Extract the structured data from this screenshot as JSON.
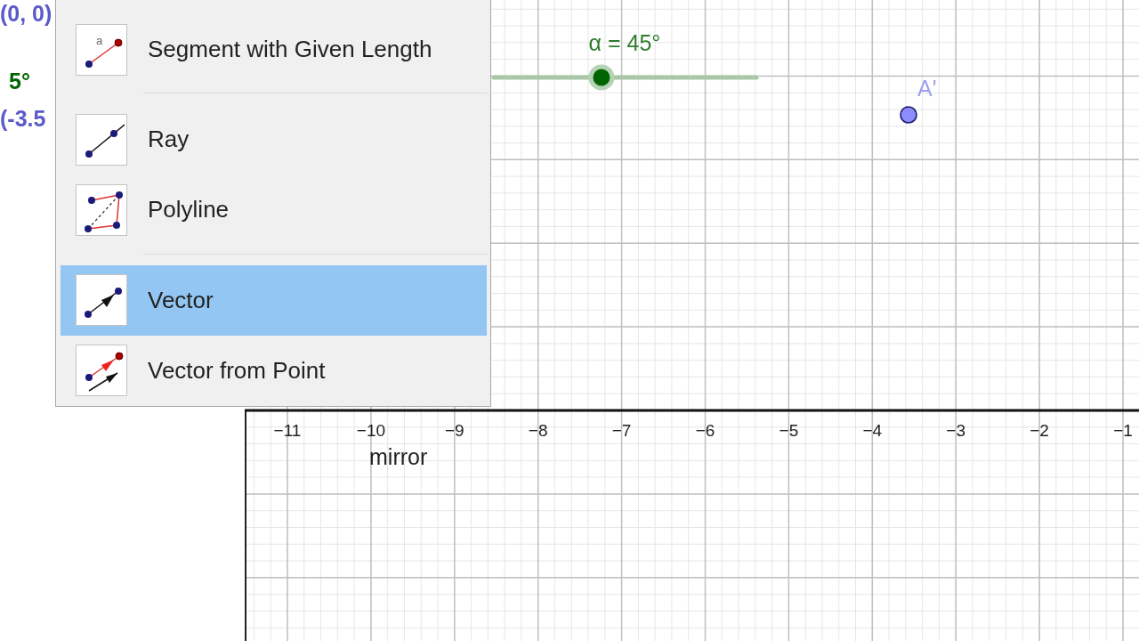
{
  "algebra_view": [
    {
      "text": "(0, 0)",
      "kind": "point"
    },
    {
      "text": "5°",
      "kind": "angle"
    },
    {
      "text": "(-3.5",
      "kind": "point"
    }
  ],
  "tool_menu": {
    "groups": [
      [
        {
          "label": "Segment with Given Length",
          "kind": "segment_length",
          "icon_label": "a",
          "selected": false
        }
      ],
      [
        {
          "label": "Ray",
          "kind": "ray",
          "selected": false
        },
        {
          "label": "Polyline",
          "kind": "polyline",
          "selected": false
        }
      ],
      [
        {
          "label": "Vector",
          "kind": "vector",
          "selected": true
        },
        {
          "label": "Vector from Point",
          "kind": "vector_from_point",
          "selected": false
        }
      ]
    ]
  },
  "graphics_view": {
    "slider": {
      "label": "α = 45°",
      "level": 0.41
    },
    "point": {
      "label": "A'"
    },
    "x_axis_labels": [
      "−11",
      "−10",
      "−9",
      "−8",
      "−7",
      "−6",
      "−5",
      "−4",
      "−3",
      "−2",
      "−1"
    ],
    "text": "mirror"
  }
}
